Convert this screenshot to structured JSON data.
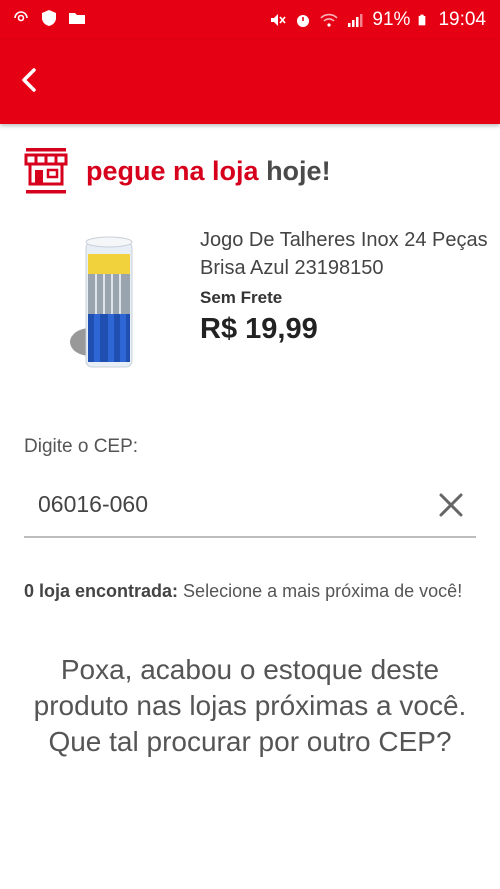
{
  "status_bar": {
    "battery": "91%",
    "time": "19:04",
    "icons": [
      "cast-icon",
      "shield-icon",
      "folder-icon",
      "mute-icon",
      "alarm-icon",
      "wifi-icon",
      "signal-icon",
      "battery-icon"
    ]
  },
  "app_bar": {
    "back_icon": "chevron-left-icon",
    "color": "#e60014"
  },
  "store": {
    "icon": "store-icon",
    "title_part1": "pegue na loja",
    "title_part2": "hoje!"
  },
  "product": {
    "name": "Jogo De Talheres Inox 24 Peças Brisa Azul 23198150",
    "shipping": "Sem Frete",
    "price": "R$ 19,99"
  },
  "cep": {
    "label": "Digite o CEP:",
    "value": "06016-060",
    "clear_icon": "close-icon"
  },
  "result": {
    "count_label": "0 loja encontrada:",
    "hint": " Selecione a mais próxima de você!"
  },
  "empty_message": "Poxa, acabou o estoque deste produto nas lojas próximas a você. Que tal procurar por outro CEP?"
}
